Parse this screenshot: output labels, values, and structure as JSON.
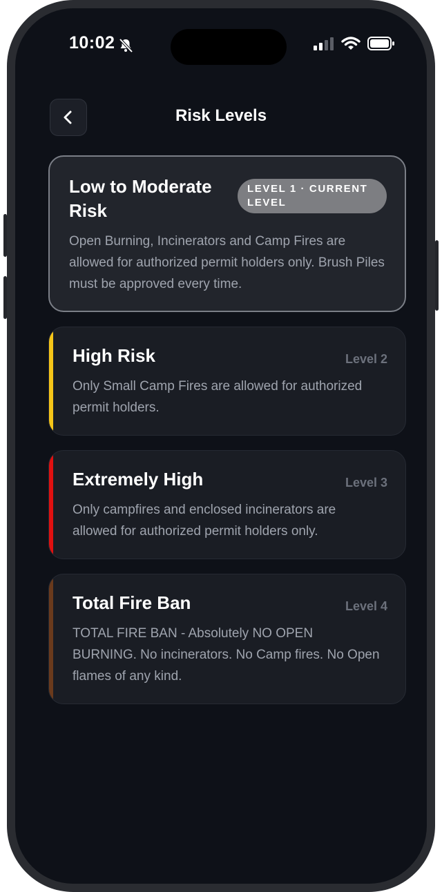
{
  "status": {
    "time": "10:02"
  },
  "header": {
    "title": "Risk Levels"
  },
  "levels": [
    {
      "title": "Low to Moderate Risk",
      "badge": "LEVEL 1 · CURRENT LEVEL",
      "description": "Open Burning, Incinerators and Camp Fires are allowed for authorized permit holders only. Brush Piles must be approved every time.",
      "accent": "#8a8d93"
    },
    {
      "title": "High Risk",
      "level": "Level 2",
      "description": "Only Small Camp Fires are allowed for authorized permit holders.",
      "accent": "#f5c518"
    },
    {
      "title": "Extremely High",
      "level": "Level 3",
      "description": "Only campfires and enclosed incinerators are allowed for authorized permit holders only.",
      "accent": "#e01010"
    },
    {
      "title": "Total Fire Ban",
      "level": "Level 4",
      "description": "TOTAL FIRE BAN - Absolutely NO OPEN BURNING. No incinerators. No Camp fires. No Open flames of any kind.",
      "accent": "#6a3a1c"
    }
  ]
}
